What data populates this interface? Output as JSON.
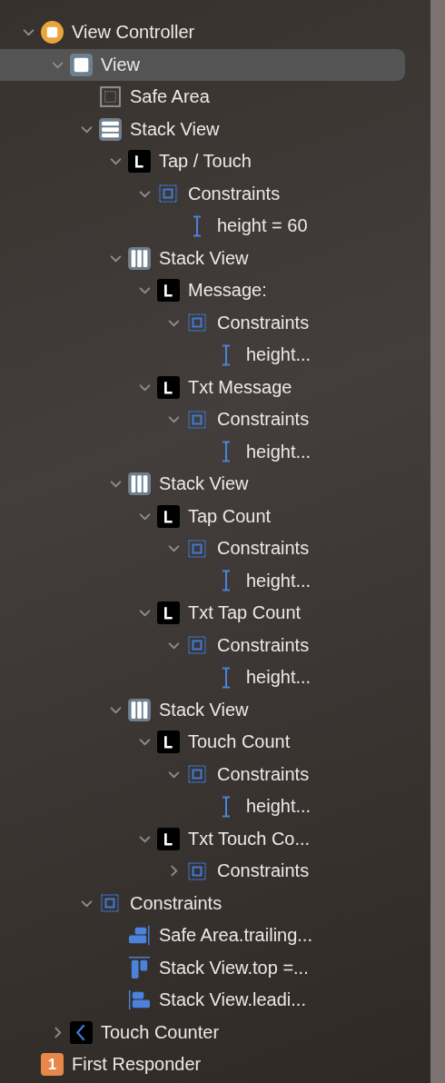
{
  "outline": [
    {
      "label": "View Controller",
      "kind": "controller",
      "expanded": true,
      "selected": false,
      "children": [
        {
          "label": "View",
          "kind": "view",
          "expanded": true,
          "selected": true,
          "children": [
            {
              "label": "Safe Area",
              "kind": "safe-area",
              "selected": false
            },
            {
              "label": "Stack View",
              "kind": "stack-vertical",
              "expanded": true,
              "selected": false,
              "children": [
                {
                  "label": "Tap / Touch",
                  "kind": "label",
                  "expanded": true,
                  "selected": false,
                  "children": [
                    {
                      "label": "Constraints",
                      "kind": "constraints",
                      "expanded": true,
                      "selected": false,
                      "children": [
                        {
                          "label": "height = 60",
                          "kind": "height",
                          "selected": false
                        }
                      ]
                    }
                  ]
                },
                {
                  "label": "Stack View",
                  "kind": "stack-horizontal",
                  "expanded": true,
                  "selected": false,
                  "children": [
                    {
                      "label": "Message:",
                      "kind": "label",
                      "expanded": true,
                      "selected": false,
                      "children": [
                        {
                          "label": "Constraints",
                          "kind": "constraints",
                          "expanded": true,
                          "selected": false,
                          "children": [
                            {
                              "label": "height...",
                              "kind": "height",
                              "selected": false
                            }
                          ]
                        }
                      ]
                    },
                    {
                      "label": "Txt Message",
                      "kind": "label",
                      "expanded": true,
                      "selected": false,
                      "children": [
                        {
                          "label": "Constraints",
                          "kind": "constraints",
                          "expanded": true,
                          "selected": false,
                          "children": [
                            {
                              "label": "height...",
                              "kind": "height",
                              "selected": false
                            }
                          ]
                        }
                      ]
                    }
                  ]
                },
                {
                  "label": "Stack View",
                  "kind": "stack-horizontal",
                  "expanded": true,
                  "selected": false,
                  "children": [
                    {
                      "label": "Tap Count",
                      "kind": "label",
                      "expanded": true,
                      "selected": false,
                      "children": [
                        {
                          "label": "Constraints",
                          "kind": "constraints",
                          "expanded": true,
                          "selected": false,
                          "children": [
                            {
                              "label": "height...",
                              "kind": "height",
                              "selected": false
                            }
                          ]
                        }
                      ]
                    },
                    {
                      "label": "Txt Tap Count",
                      "kind": "label",
                      "expanded": true,
                      "selected": false,
                      "children": [
                        {
                          "label": "Constraints",
                          "kind": "constraints",
                          "expanded": true,
                          "selected": false,
                          "children": [
                            {
                              "label": "height...",
                              "kind": "height",
                              "selected": false
                            }
                          ]
                        }
                      ]
                    }
                  ]
                },
                {
                  "label": "Stack View",
                  "kind": "stack-horizontal",
                  "expanded": true,
                  "selected": false,
                  "children": [
                    {
                      "label": "Touch Count",
                      "kind": "label",
                      "expanded": true,
                      "selected": false,
                      "children": [
                        {
                          "label": "Constraints",
                          "kind": "constraints",
                          "expanded": true,
                          "selected": false,
                          "children": [
                            {
                              "label": "height...",
                              "kind": "height",
                              "selected": false
                            }
                          ]
                        }
                      ]
                    },
                    {
                      "label": "Txt Touch Co...",
                      "kind": "label",
                      "expanded": true,
                      "selected": false,
                      "children": [
                        {
                          "label": "Constraints",
                          "kind": "constraints",
                          "expanded": false,
                          "selected": false
                        }
                      ]
                    }
                  ]
                }
              ]
            },
            {
              "label": "Constraints",
              "kind": "constraints",
              "expanded": true,
              "selected": false,
              "children": [
                {
                  "label": "Safe Area.trailing...",
                  "kind": "trailing",
                  "selected": false
                },
                {
                  "label": "Stack View.top =...",
                  "kind": "top",
                  "selected": false
                },
                {
                  "label": "Stack View.leadi...",
                  "kind": "leading",
                  "selected": false
                }
              ]
            }
          ]
        },
        {
          "label": "Touch Counter",
          "kind": "navigation",
          "expanded": false,
          "selected": false
        }
      ]
    },
    {
      "label": "First Responder",
      "kind": "responder",
      "badge": "1",
      "selected": false
    }
  ]
}
